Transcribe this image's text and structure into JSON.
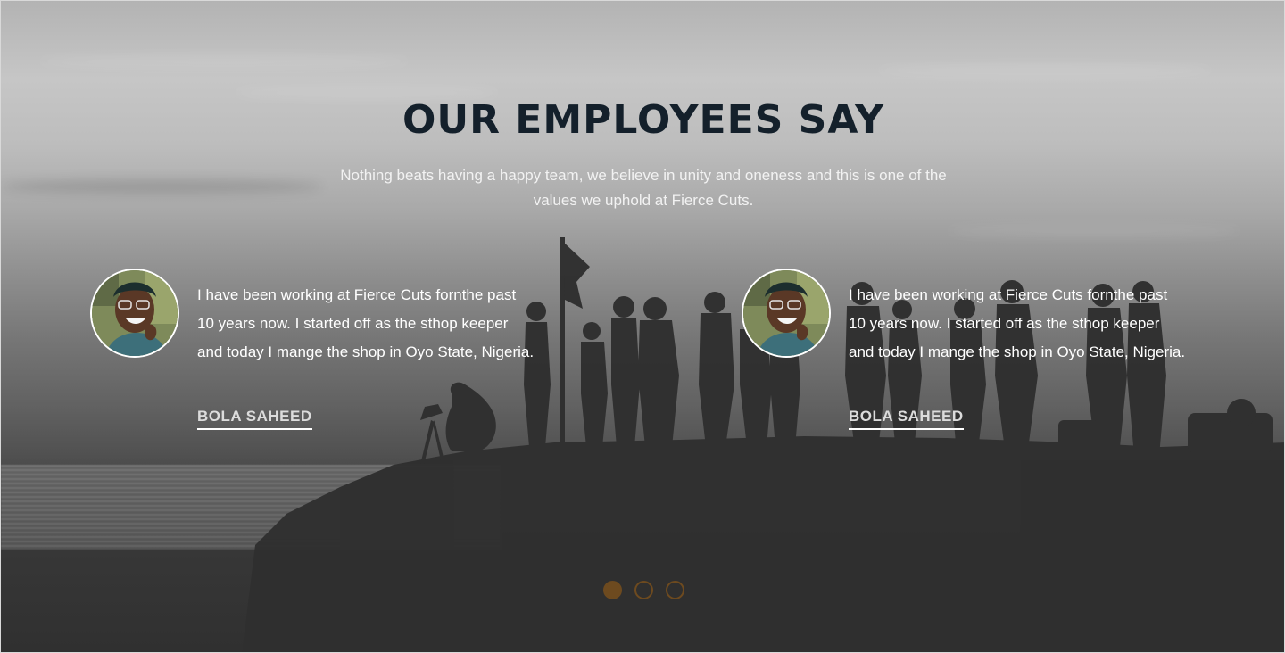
{
  "section": {
    "heading": "OUR EMPLOYEES SAY",
    "subtitle": "Nothing beats having a happy team, we believe in unity and oneness and this is one of the values we uphold at Fierce Cuts."
  },
  "testimonials": [
    {
      "quote": "I have been working at Fierce Cuts fornthe past 10 years now. I started off as the sthop keeper and today I mange the shop in Oyo State, Nigeria.",
      "name": "BOLA SAHEED",
      "avatar_icon": "person-avatar-icon"
    },
    {
      "quote": "I have been working at Fierce Cuts fornthe past 10 years now. I started off as the sthop keeper and today I mange the shop in Oyo State, Nigeria.",
      "name": "BOLA SAHEED",
      "avatar_icon": "person-avatar-icon"
    }
  ],
  "pagination": {
    "active_index": 0,
    "total": 3
  },
  "colors": {
    "heading": "#14202b",
    "accent": "#6d4a1f",
    "text": "#ffffff",
    "ground": "#303030"
  }
}
